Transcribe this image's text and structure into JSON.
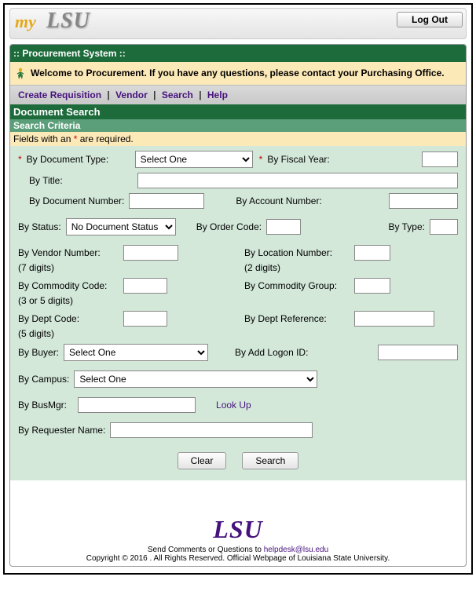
{
  "topbar": {
    "logo_my": "my",
    "logo_lsu": "LSU",
    "logout": "Log Out"
  },
  "system_title": ":: Procurement System ::",
  "welcome": "Welcome to Procurement. If you have any questions, please contact your Purchasing Office.",
  "menu": {
    "create": "Create Requisition",
    "vendor": "Vendor",
    "search": "Search",
    "help": "Help"
  },
  "section": {
    "title": "Document Search",
    "sub": "Search Criteria"
  },
  "required_note": {
    "pre": "Fields with an ",
    "post": " are required."
  },
  "labels": {
    "doc_type": "By Document Type:",
    "fiscal_year": "By Fiscal Year:",
    "title": "By Title:",
    "doc_num": "By Document Number:",
    "account_num": "By Account Number:",
    "status": "By Status:",
    "order_code": "By Order Code:",
    "type": "By Type:",
    "vendor_num": "By Vendor Number:",
    "vendor_hint": "(7 digits)",
    "location_num": "By Location Number:",
    "location_hint": "(2 digits)",
    "commodity_code": "By Commodity Code:",
    "commodity_hint": "(3 or 5 digits)",
    "commodity_group": "By Commodity Group:",
    "dept_code": "By Dept Code:",
    "dept_hint": "(5 digits)",
    "dept_ref": "By Dept Reference:",
    "buyer": "By Buyer:",
    "add_logon": "By Add Logon ID:",
    "campus": "By Campus:",
    "busmgr": "By BusMgr:",
    "lookup": "Look Up",
    "requester": "By Requester Name:"
  },
  "selects": {
    "doc_type": "Select One",
    "status": "No Document Status",
    "buyer": "Select One",
    "campus": "Select One"
  },
  "buttons": {
    "clear": "Clear",
    "search": "Search"
  },
  "footer": {
    "brand": "LSU",
    "line1a": "Send Comments or Questions to ",
    "email": "helpdesk@lsu.edu",
    "line2": "Copyright © 2016 . All Rights Reserved. Official Webpage of Louisiana State University."
  }
}
